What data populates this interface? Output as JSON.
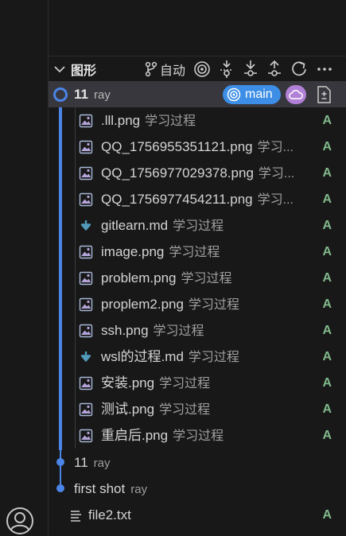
{
  "header": {
    "title": "图形",
    "auto_label": "自动"
  },
  "colors": {
    "accent": "#3d8ee7",
    "graph_line": "#4b85e8",
    "cloud_badge": "#b180d7",
    "added": "#81b88b"
  },
  "commits": [
    {
      "label": "11",
      "author": "ray",
      "selected": true,
      "branch": "main"
    },
    {
      "label": "11",
      "author": "ray"
    },
    {
      "label": "first shot",
      "author": "ray"
    }
  ],
  "files": [
    {
      "name": ".lll.png",
      "dir": "学习过程",
      "status": "A",
      "icon": "image-file-icon"
    },
    {
      "name": "QQ_1756955351121.png",
      "dir": "学习...",
      "status": "A",
      "icon": "image-file-icon"
    },
    {
      "name": "QQ_1756977029378.png",
      "dir": "学习...",
      "status": "A",
      "icon": "image-file-icon"
    },
    {
      "name": "QQ_1756977454211.png",
      "dir": "学习...",
      "status": "A",
      "icon": "image-file-icon"
    },
    {
      "name": "gitlearn.md",
      "dir": "学习过程",
      "status": "A",
      "icon": "markdown-file-icon"
    },
    {
      "name": "image.png",
      "dir": "学习过程",
      "status": "A",
      "icon": "image-file-icon"
    },
    {
      "name": "problem.png",
      "dir": "学习过程",
      "status": "A",
      "icon": "image-file-icon"
    },
    {
      "name": "proplem2.png",
      "dir": "学习过程",
      "status": "A",
      "icon": "image-file-icon"
    },
    {
      "name": "ssh.png",
      "dir": "学习过程",
      "status": "A",
      "icon": "image-file-icon"
    },
    {
      "name": "wsl的过程.md",
      "dir": "学习过程",
      "status": "A",
      "icon": "markdown-file-icon"
    },
    {
      "name": "安装.png",
      "dir": "学习过程",
      "status": "A",
      "icon": "image-file-icon"
    },
    {
      "name": "测试.png",
      "dir": "学习过程",
      "status": "A",
      "icon": "image-file-icon"
    },
    {
      "name": "重启后.png",
      "dir": "学习过程",
      "status": "A",
      "icon": "image-file-icon"
    }
  ],
  "last_commit_files": [
    {
      "name": "file2.txt",
      "status": "A",
      "icon": "text-file-icon"
    }
  ]
}
